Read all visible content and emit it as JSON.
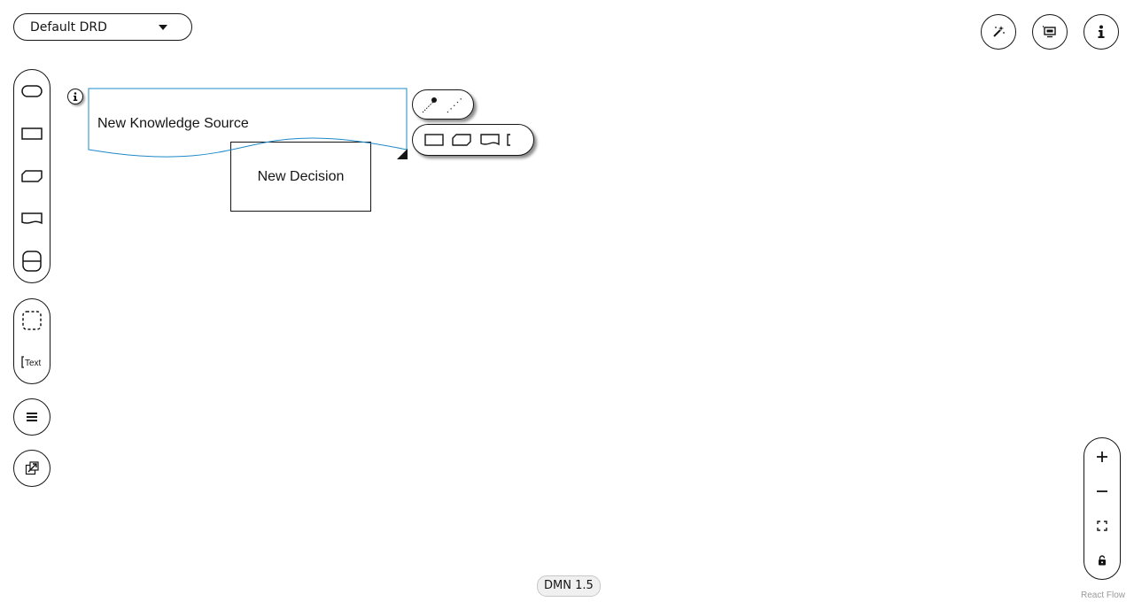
{
  "drd_selector": {
    "label": "Default DRD"
  },
  "top_actions": [
    {
      "icon": "magic-wand-icon"
    },
    {
      "icon": "overlays-icon"
    },
    {
      "icon": "info-icon"
    }
  ],
  "palette": {
    "nodes": [
      {
        "icon": "input-data-node-icon"
      },
      {
        "icon": "decision-node-icon"
      },
      {
        "icon": "bkm-node-icon"
      },
      {
        "icon": "knowledge-source-node-icon"
      },
      {
        "icon": "decision-service-node-icon"
      }
    ],
    "extras": [
      {
        "icon": "group-node-icon"
      },
      {
        "icon": "text-annotation-node-icon",
        "label": "Text"
      }
    ],
    "drg_list_icon": "list-icon",
    "external_models_icon": "external-link-icon"
  },
  "canvas": {
    "knowledge_source": {
      "label": "New Knowledge Source"
    },
    "decision": {
      "label": "New Decision"
    }
  },
  "zoom": [
    {
      "icon": "zoom-in-icon"
    },
    {
      "icon": "zoom-out-icon"
    },
    {
      "icon": "fit-view-icon"
    },
    {
      "icon": "lock-icon"
    }
  ],
  "footer": {
    "version": "DMN 1.5",
    "attribution": "React Flow"
  }
}
